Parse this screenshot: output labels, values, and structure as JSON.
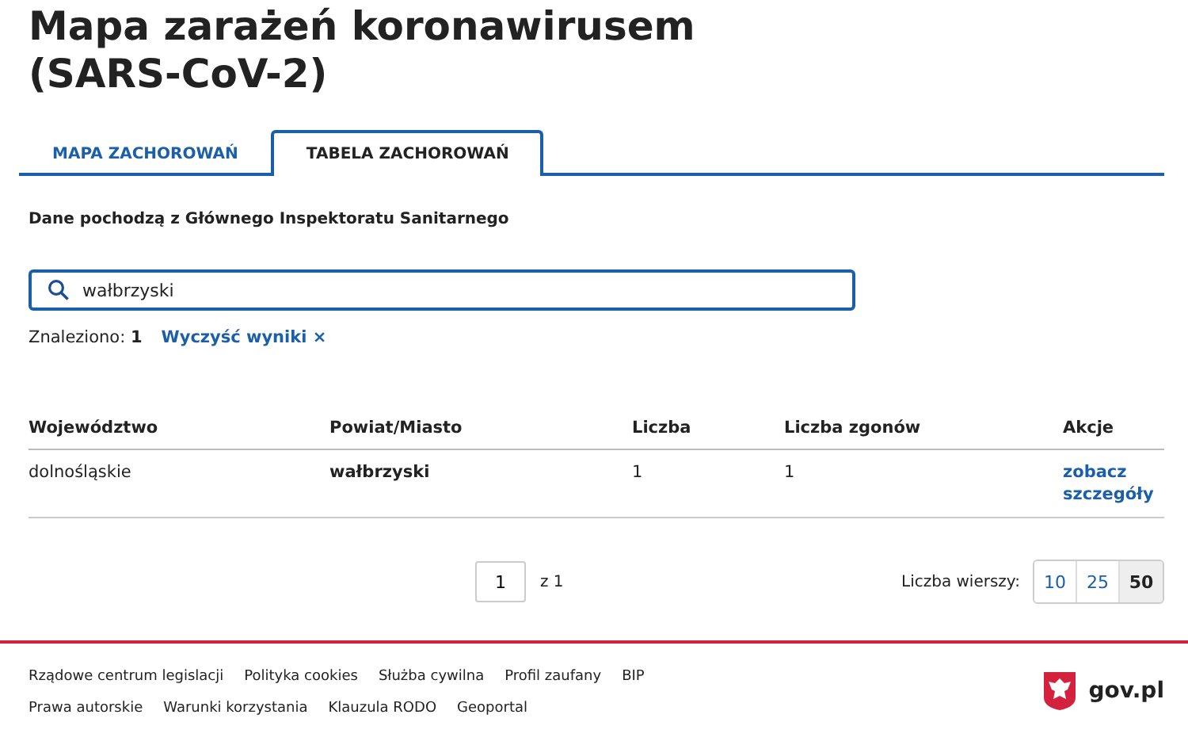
{
  "title_lines": [
    "Mapa zarażeń koronawirusem",
    "(SARS-CoV-2)"
  ],
  "tabs": [
    {
      "label": "MAPA ZACHOROWAŃ",
      "selected": false
    },
    {
      "label": "TABELA ZACHOROWAŃ",
      "selected": true
    }
  ],
  "source_note": "Dane pochodzą z Głównego Inspektoratu Sanitarnego",
  "search": {
    "value": "wałbrzyski"
  },
  "results": {
    "label": "Znaleziono:",
    "count": "1",
    "clear_link": "Wyczyść wyniki",
    "clear_icon": "×"
  },
  "table": {
    "columns": [
      "Województwo",
      "Powiat/Miasto",
      "Liczba",
      "Liczba zgonów",
      "Akcje"
    ],
    "rows": [
      {
        "cells": [
          "dolnośląskie",
          "wałbrzyski",
          "1",
          "1"
        ],
        "action": "zobacz szczegóły"
      }
    ]
  },
  "pagination": {
    "page": "1",
    "of": "z 1",
    "rows_label": "Liczba wierszy:",
    "sizes": [
      {
        "label": "10",
        "selected": false
      },
      {
        "label": "25",
        "selected": false
      },
      {
        "label": "50",
        "selected": true
      }
    ]
  },
  "footer": {
    "links_row_1": [
      "Rządowe centrum legislacji",
      "Polityka cookies",
      "Służba cywilna",
      "Profil zaufany",
      "BIP"
    ],
    "links_row_2": [
      "Prawa autorskie",
      "Warunki korzystania",
      "Klauzula RODO",
      "Geoportal"
    ],
    "logo_text": "gov.pl"
  }
}
